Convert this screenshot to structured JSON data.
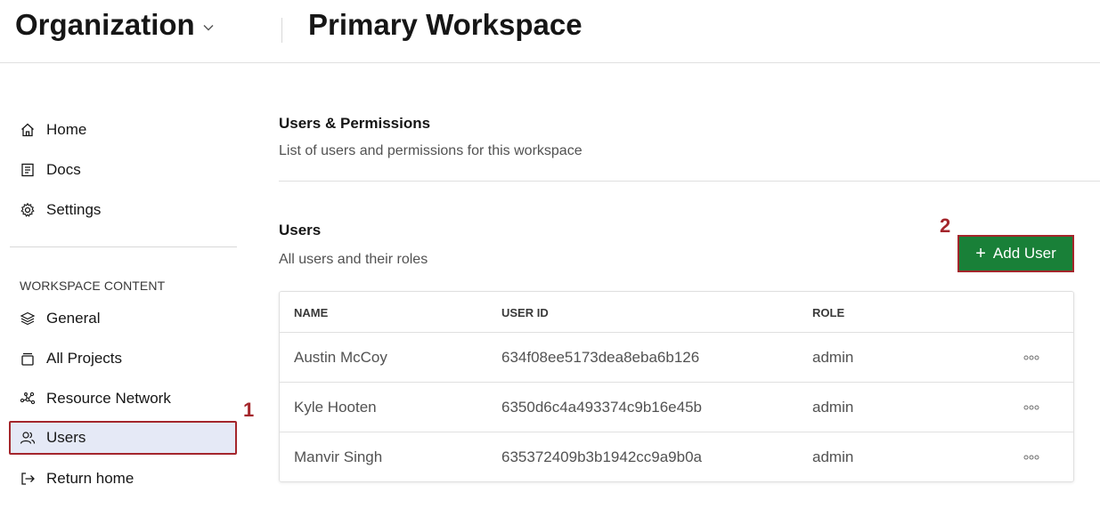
{
  "header": {
    "org_title": "Organization",
    "workspace_title": "Primary Workspace"
  },
  "sidebar": {
    "items": [
      {
        "label": "Home",
        "icon": "home-icon"
      },
      {
        "label": "Docs",
        "icon": "docs-icon"
      },
      {
        "label": "Settings",
        "icon": "gear-icon"
      }
    ],
    "section_label": "WORKSPACE CONTENT",
    "content_items": [
      {
        "label": "General",
        "icon": "layers-icon"
      },
      {
        "label": "All Projects",
        "icon": "archive-icon"
      },
      {
        "label": "Resource Network",
        "icon": "network-icon"
      },
      {
        "label": "Users",
        "icon": "users-icon",
        "active": true
      },
      {
        "label": "Return home",
        "icon": "exit-icon"
      }
    ]
  },
  "annotations": {
    "step1": "1",
    "step2": "2"
  },
  "main": {
    "permissions_title": "Users & Permissions",
    "permissions_subtitle": "List of users and permissions for this workspace",
    "users_title": "Users",
    "users_subtitle": "All users and their roles",
    "add_user_label": "Add User",
    "table": {
      "headers": [
        "NAME",
        "USER ID",
        "ROLE"
      ],
      "rows": [
        {
          "name": "Austin McCoy",
          "user_id": "634f08ee5173dea8eba6b126",
          "role": "admin"
        },
        {
          "name": "Kyle Hooten",
          "user_id": "6350d6c4a493374c9b16e45b",
          "role": "admin"
        },
        {
          "name": "Manvir Singh",
          "user_id": "635372409b3b1942cc9a9b0a",
          "role": "admin"
        }
      ]
    }
  },
  "colors": {
    "primary_button": "#198038",
    "annotation": "#a4262c",
    "active_nav_bg": "#e5e9f6"
  }
}
